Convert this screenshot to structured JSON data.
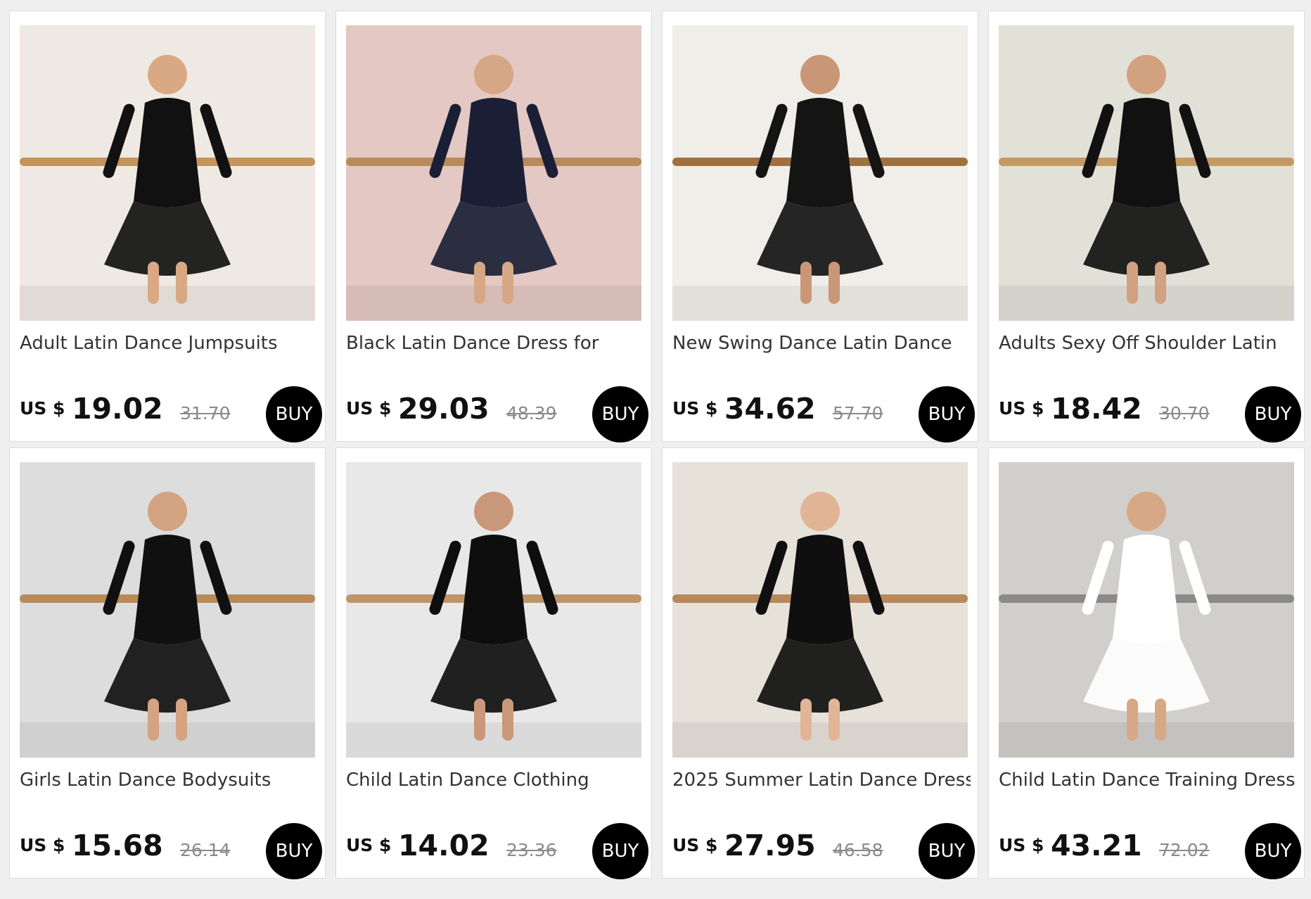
{
  "products": [
    {
      "title": "Adult Latin Dance Jumpsuits",
      "currency": "US $",
      "price": "19.02",
      "old_price": "31.70",
      "buy_label": "BUY",
      "image": {
        "icon": "dancer-black-jumpsuit-photo",
        "bg": "#ece7de",
        "fg": "#111111",
        "accent": "#c4945a",
        "skin": "#d9a884"
      }
    },
    {
      "title": "Black Latin Dance Dress for",
      "currency": "US $",
      "price": "29.03",
      "old_price": "48.39",
      "buy_label": "BUY",
      "image": {
        "icon": "dancer-navy-dress-photo",
        "bg": "#e0bfb9",
        "fg": "#1b1f36",
        "accent": "#b98a5c",
        "skin": "#d6a785"
      }
    },
    {
      "title": "New Swing Dance Latin Dance",
      "currency": "US $",
      "price": "34.62",
      "old_price": "57.70",
      "buy_label": "BUY",
      "image": {
        "icon": "dancer-leopard-fringe-dress-photo",
        "bg": "#eeece6",
        "fg": "#141414",
        "accent": "#a0703f",
        "skin": "#c99776"
      }
    },
    {
      "title": "Adults Sexy Off Shoulder Latin",
      "currency": "US $",
      "price": "18.42",
      "old_price": "30.70",
      "buy_label": "BUY",
      "image": {
        "icon": "dancer-off-shoulder-set-photo",
        "bg": "#dcdcd2",
        "fg": "#111111",
        "accent": "#c49a62",
        "skin": "#d2a180"
      }
    },
    {
      "title": "Girls Latin Dance Bodysuits",
      "currency": "US $",
      "price": "15.68",
      "old_price": "26.14",
      "buy_label": "BUY",
      "image": {
        "icon": "girls-black-bodysuit-photo",
        "bg": "#d8d8d8",
        "fg": "#101010",
        "accent": "#b88a58",
        "skin": "#d4a381"
      }
    },
    {
      "title": "Child Latin Dance Clothing",
      "currency": "US $",
      "price": "14.02",
      "old_price": "23.36",
      "buy_label": "BUY",
      "image": {
        "icon": "child-mesh-sleeve-bodysuit-photo",
        "bg": "#e4e4e4",
        "fg": "#0e0e0e",
        "accent": "#bf9468",
        "skin": "#c9987a"
      }
    },
    {
      "title": "2025 Summer Latin Dance Dress",
      "currency": "US $",
      "price": "27.95",
      "old_price": "46.58",
      "buy_label": "BUY",
      "image": {
        "icon": "dancer-halter-ruffle-dress-photo",
        "bg": "#e2ddd4",
        "fg": "#0f0f0f",
        "accent": "#b7895a",
        "skin": "#e2b496"
      }
    },
    {
      "title": "Child Latin Dance Training Dress",
      "currency": "US $",
      "price": "43.21",
      "old_price": "72.02",
      "buy_label": "BUY",
      "image": {
        "icon": "child-group-white-dress-photo",
        "bg": "#c9c7c2",
        "fg": "#ffffff",
        "accent": "#8a8a8a",
        "skin": "#d7a886"
      }
    }
  ]
}
